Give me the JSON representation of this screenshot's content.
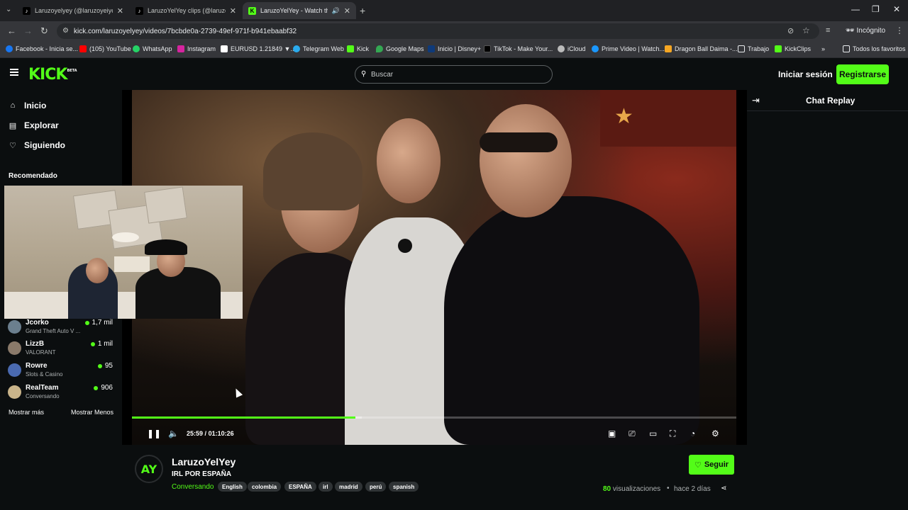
{
  "browser": {
    "tabs": [
      {
        "title": "Laruzoyelyey (@laruzoyeiyey) |",
        "icon": "tiktok-icon",
        "active": false
      },
      {
        "title": "LaruzoYelYey clips (@laruzo_y_",
        "icon": "tiktok-icon",
        "active": false
      },
      {
        "title": "LaruzoYelYey - Watch the V",
        "icon": "kick-icon",
        "active": true
      }
    ],
    "url": "kick.com/laruzoyelyey/videos/7bcbde0a-2739-49ef-971f-b941ebaabf32",
    "incognito_label": "Incógnito",
    "bookmarks": [
      "Facebook - Inicia se...",
      "(105) YouTube",
      "WhatsApp",
      "Instagram",
      "EURUSD 1.21849 ▼...",
      "Telegram Web",
      "Kick",
      "Google Maps",
      "Inicio | Disney+",
      "TikTok - Make Your...",
      "iCloud",
      "Prime Video | Watch...",
      "Dragon Ball Daima -...",
      "Trabajo",
      "KickClips"
    ],
    "all_bookmarks": "Todos los favoritos"
  },
  "header": {
    "logo": "KICK",
    "logo_badge": "BETA",
    "search_placeholder": "Buscar",
    "login": "Iniciar sesión",
    "register": "Registrarse"
  },
  "sidebar": {
    "nav": [
      {
        "label": "Inicio",
        "icon": "home-icon"
      },
      {
        "label": "Explorar",
        "icon": "explore-icon"
      },
      {
        "label": "Siguiendo",
        "icon": "heart-icon"
      }
    ],
    "recommended_title": "Recomendado",
    "channels": [
      {
        "name": "Jcorko",
        "category": "Grand Theft Auto V ...",
        "viewers": "1,7 mil",
        "color": "#6b7f8e"
      },
      {
        "name": "LizzB",
        "category": "VALORANT",
        "viewers": "1 mil",
        "color": "#8a7a6a"
      },
      {
        "name": "Rowre",
        "category": "Slots & Casino",
        "viewers": "95",
        "color": "#4a6ab0"
      },
      {
        "name": "RealTeam",
        "category": "Conversando",
        "viewers": "906",
        "color": "#c9b48a"
      }
    ],
    "show_more": "Mostrar más",
    "show_less": "Mostrar Menos"
  },
  "player": {
    "current_time": "25:59",
    "total_time": "01:10:26",
    "progress": 0.37,
    "buffered": 0.38
  },
  "chat": {
    "title": "Chat Replay"
  },
  "channel": {
    "avatar_text": "AY",
    "name": "LaruzoYelYey",
    "stream_title": "IRL POR ESPAÑA",
    "category": "Conversando",
    "tags": [
      "English",
      "colombia",
      "ESPAÑA",
      "irl",
      "madrid",
      "perú",
      "spanish"
    ],
    "follow": "Seguir",
    "views_count": "80",
    "views_label": "visualizaciones",
    "ago": "hace 2 días"
  },
  "colors": {
    "accent": "#53fc18",
    "background": "#0b0e0f"
  }
}
